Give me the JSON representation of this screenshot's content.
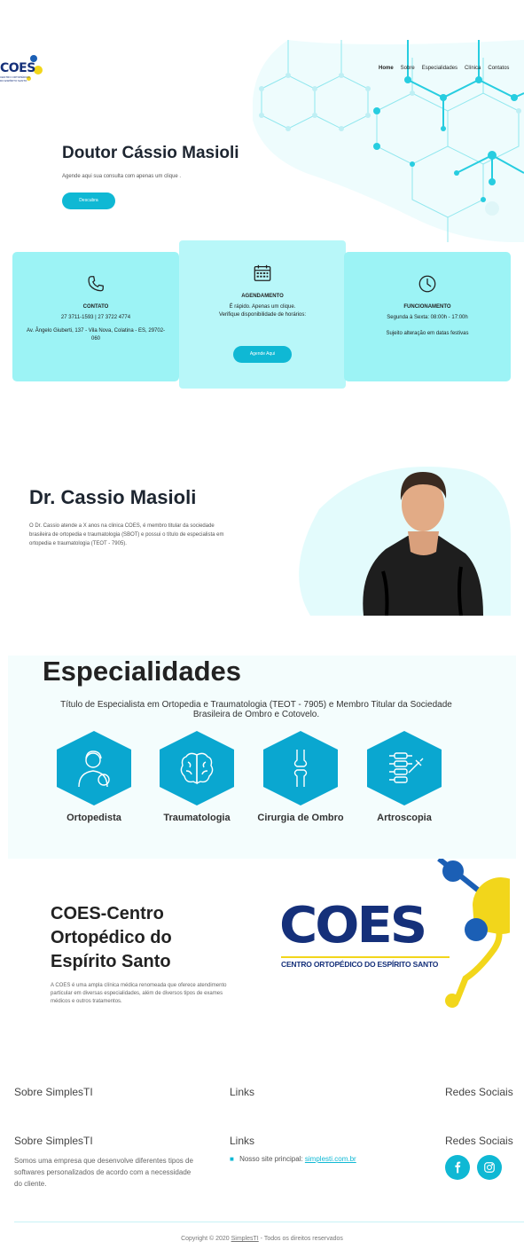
{
  "header": {
    "logo_text": "COES",
    "logo_sub": "CENTRO ORTOPÉDICO DO ESPÍRITO SANTO",
    "nav": [
      "Home",
      "Sobre",
      "Especialidades",
      "Clínica",
      "Contatos"
    ]
  },
  "hero": {
    "title": "Doutor Cássio Masioli",
    "subtitle": "Agende aqui sua consulta com apenas um clique .",
    "button": "Descubra"
  },
  "cards": {
    "contact": {
      "icon": "phone-icon",
      "title": "CONTATO",
      "phones": "27 3711-1593 | 27 3722 4774",
      "address": "Av. Ângelo Giuberti, 137 - Vila Nova, Colatina - ES, 29702-060"
    },
    "agenda": {
      "icon": "calendar-icon",
      "title": "AGENDAMENTO",
      "line1": "É rápido. Apenas um clique.",
      "line2": "Verifique disponibilidade de horários:",
      "button": "Agende Aqui"
    },
    "hours": {
      "icon": "clock-icon",
      "title": "FUNCIONAMENTO",
      "line1": "Segunda à Sexta: 08:00h - 17:00h",
      "line2": "Sujeito alteração em datas festivas"
    }
  },
  "doctor": {
    "title_bold": "Dr. Cassio",
    "title_light": "Masioli",
    "text": "O Dr. Cassio atende a X anos na clinica COES, é membro titular da sociedade brasileira de ortopedia e traumatologia (SBOT) e possui o título de especialista em ortopedia e traumatologia (TEOT - 7905)."
  },
  "specialties": {
    "title": "Especialidades",
    "text": "Título de Especialista em Ortopedia e Traumatologia (TEOT - 7905) e Membro Titular da Sociedade Brasileira de Ombro e Cotovelo.",
    "items": [
      {
        "label": "Ortopedista",
        "icon": "doctor-icon"
      },
      {
        "label": "Traumatologia",
        "icon": "brain-icon"
      },
      {
        "label": "Cirurgia de Ombro",
        "icon": "bone-joint-icon"
      },
      {
        "label": "Artroscopia",
        "icon": "spine-syringe-icon"
      }
    ]
  },
  "coes": {
    "title_bold": "COES-",
    "title_rest1": "Centro",
    "title_rest2": "Ortopédico do",
    "title_rest3": "Espírito Santo",
    "text": "A COES é uma ampla clínica médica renomeada que oferece atendimento particular em diversas especialidades, além de diversos tipos de exames médicos e outros tratamentos.",
    "logo_big": "COES",
    "logo_caption": "CENTRO ORTOPÉDICO DO ESPÍRITO SANTO"
  },
  "footer": {
    "top_heads": [
      "Sobre SimplesTI",
      "Links",
      "Redes Sociais"
    ],
    "heads": [
      "Sobre SimplesTI",
      "Links",
      "Redes Sociais"
    ],
    "about": "Somos uma empresa que desenvolve diferentes tipos de softwares personalizados de acordo com a necessidade do cliente.",
    "link_prefix": "Nosso site principal:",
    "link_text": "simplesti.com.br",
    "social": [
      "facebook-icon",
      "instagram-icon"
    ],
    "copyright_prefix": "Copyright © 2020",
    "copyright_link": "SimplesTI",
    "copyright_suffix": "- Todos os direitos reservados"
  },
  "colors": {
    "accent": "#0fb8d4",
    "card": "#9cf3f5",
    "navy": "#15307a",
    "yellow": "#f2d61b"
  }
}
